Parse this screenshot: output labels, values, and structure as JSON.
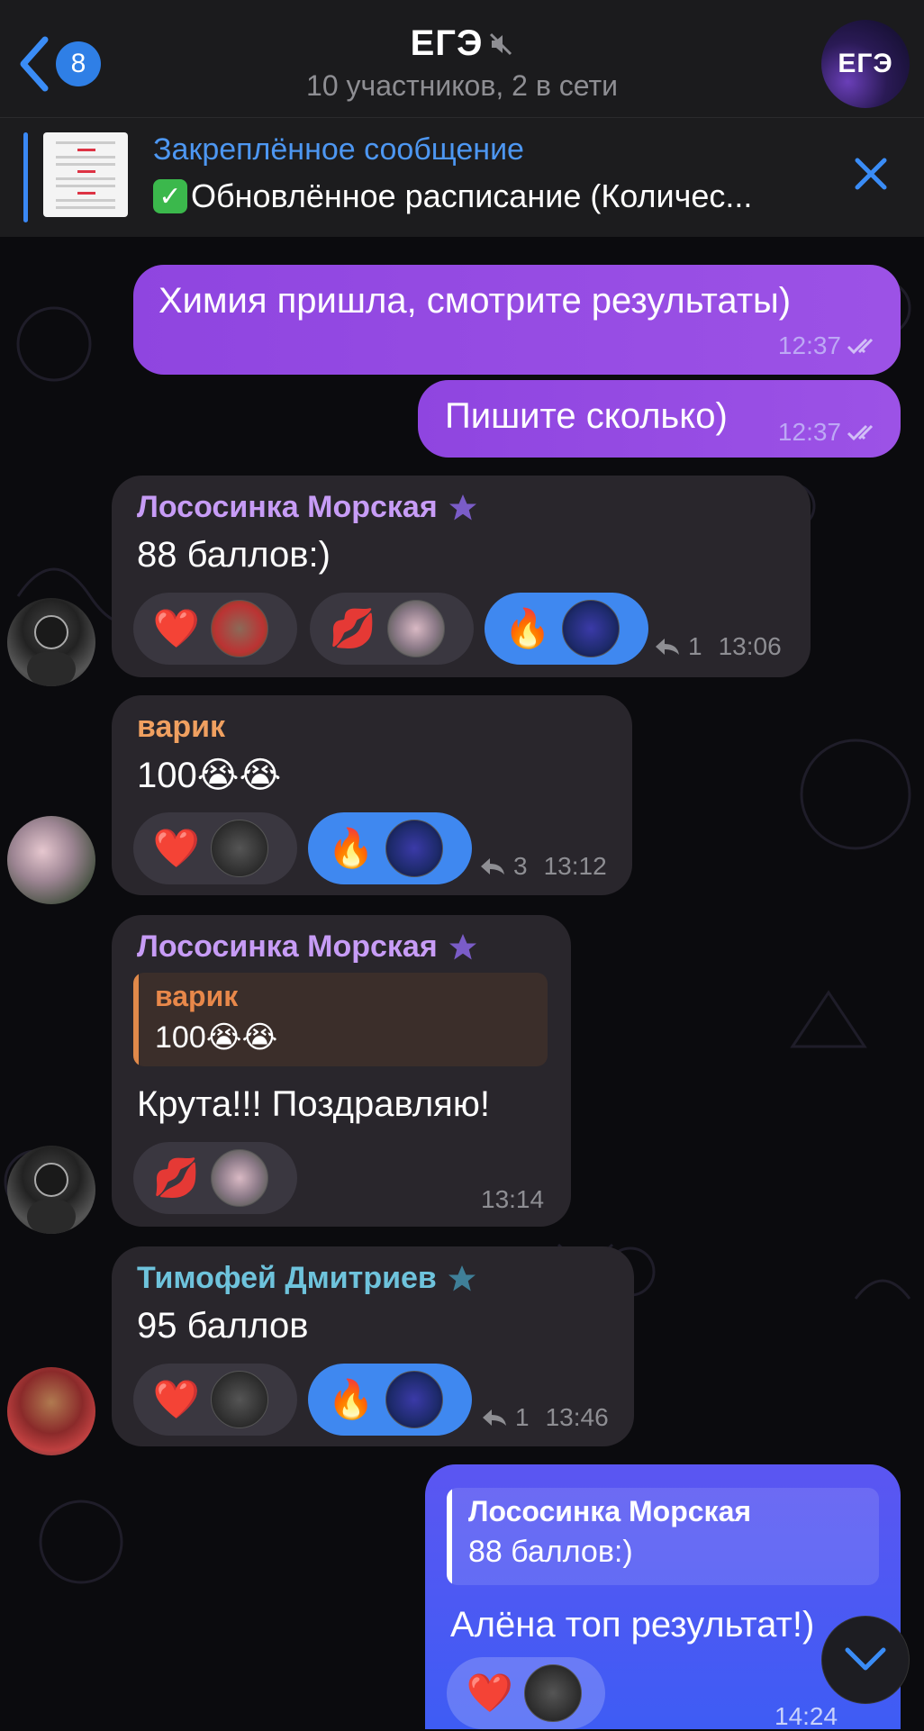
{
  "header": {
    "back_count": "8",
    "title": "ЕГЭ",
    "subtitle": "10 участников, 2 в сети",
    "avatar_text": "ЕГЭ"
  },
  "pinned": {
    "label": "Закреплённое сообщение",
    "text": "Обновлённое расписание (Количес..."
  },
  "messages": [
    {
      "text": "Химия пришла, смотрите результаты)",
      "time": "12:37"
    },
    {
      "text": "Пишите сколько)",
      "time": "12:37"
    },
    {
      "sender": "Лососинка Морская",
      "text": "88 баллов:)",
      "replies": "1",
      "time": "13:06"
    },
    {
      "sender": "варик",
      "text": "100😭😭",
      "replies": "3",
      "time": "13:12"
    },
    {
      "sender": "Лососинка Морская",
      "quote_name": "варик",
      "quote_text": "100😭😭",
      "text": "Крута!!! Поздравляю!",
      "time": "13:14"
    },
    {
      "sender": "Тимофей Дмитриев",
      "text": "95 баллов",
      "replies": "1",
      "time": "13:46"
    },
    {
      "quote_name": "Лососинка Морская",
      "quote_text": "88 баллов:)",
      "text": "Алёна топ результат!)",
      "time": "14:24"
    }
  ],
  "reactions": {
    "heart": "❤️",
    "kiss": "💋",
    "fire": "🔥",
    "check": "✅"
  },
  "colors": {
    "accent": "#3f88f0",
    "outgoing": "#9a4fe6",
    "incoming": "#29262c",
    "sender_purple": "#c79cf6",
    "sender_orange": "#f0a060",
    "sender_teal": "#6ec3dc"
  }
}
